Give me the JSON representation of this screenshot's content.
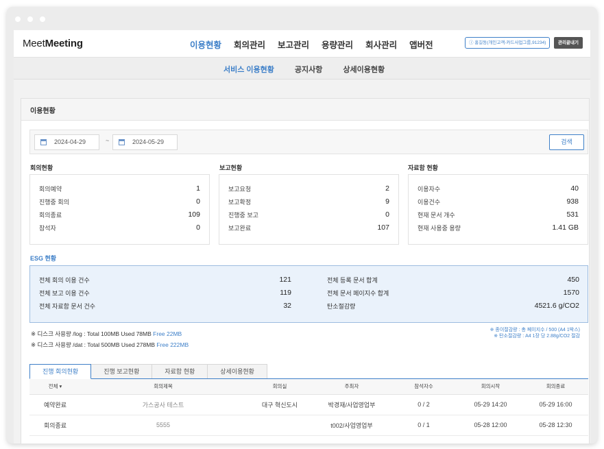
{
  "brand": {
    "prefix": "Meet",
    "bold": "Meeting"
  },
  "main_nav": [
    "이용현황",
    "회의관리",
    "보고관리",
    "용량관리",
    "회사관리",
    "앱버전"
  ],
  "user_label": "ⓘ 홍길동(개인고객-카드사업그룹,91234)",
  "admin_button": "관리끝내기",
  "sub_nav": [
    "서비스 이용현황",
    "공지사항",
    "상세이용현황"
  ],
  "page_title": "이용현황",
  "date_from": "2024-04-29",
  "date_sep": "~",
  "date_to": "2024-05-29",
  "search_label": "검색",
  "sections": {
    "meeting": {
      "title": "회의현황",
      "rows": [
        {
          "label": "회의예약",
          "value": "1"
        },
        {
          "label": "진행중 회의",
          "value": "0"
        },
        {
          "label": "회의종료",
          "value": "109"
        },
        {
          "label": "참석자",
          "value": "0"
        }
      ]
    },
    "report": {
      "title": "보고현황",
      "rows": [
        {
          "label": "보고요청",
          "value": "2"
        },
        {
          "label": "보고확정",
          "value": "9"
        },
        {
          "label": "진행중 보고",
          "value": "0"
        },
        {
          "label": "보고완료",
          "value": "107"
        }
      ]
    },
    "archive": {
      "title": "자료함 현황",
      "rows": [
        {
          "label": "이용자수",
          "value": "40"
        },
        {
          "label": "이용건수",
          "value": "938"
        },
        {
          "label": "현재 문서 개수",
          "value": "531"
        },
        {
          "label": "현재 사용중 용량",
          "value": "1.41 GB"
        }
      ]
    }
  },
  "esg": {
    "title": "ESG 현황",
    "left": [
      {
        "label": "전체 회의 이용 건수",
        "value": "121"
      },
      {
        "label": "전체 보고 이용 건수",
        "value": "119"
      },
      {
        "label": "전체 자료함 문서 건수",
        "value": "32"
      }
    ],
    "right": [
      {
        "label": "전체 등록 문서 합계",
        "value": "450"
      },
      {
        "label": "전체 문서 페이지수 합계",
        "value": "1570"
      },
      {
        "label": "탄소절감량",
        "value": "4521.6 g/CO2"
      }
    ]
  },
  "disk": [
    {
      "prefix": "※ 디스크 사용량 /log : Total 100MB Used 78MB",
      "free": "Free 22MB"
    },
    {
      "prefix": "※ 디스크 사용량 /dat : Total 500MB Used 278MB",
      "free": "Free 222MB"
    }
  ],
  "notes": [
    "※ 종이절감량 : 총 페이지수 / 500 (A4 1박스)",
    "※ 탄소절감량 : A4 1장 당 2.88g/CO2 절감"
  ],
  "tabs": [
    "진행 회의현황",
    "진행 보고현황",
    "자료함 현황",
    "상세이용현황"
  ],
  "table": {
    "headers": [
      "전체 ▾",
      "회의제목",
      "회의실",
      "주최자",
      "참석자수",
      "회의시작",
      "회의종료"
    ],
    "rows": [
      [
        "예약완료",
        "가스공사 테스트",
        "대구 혁신도시",
        "박경재/사업영업부",
        "0 / 2",
        "05-29 14:20",
        "05-29 16:00"
      ],
      [
        "회의종료",
        "5555",
        "",
        "t002/사업영업부",
        "0 / 1",
        "05-28 12:00",
        "05-28 12:30"
      ]
    ]
  }
}
